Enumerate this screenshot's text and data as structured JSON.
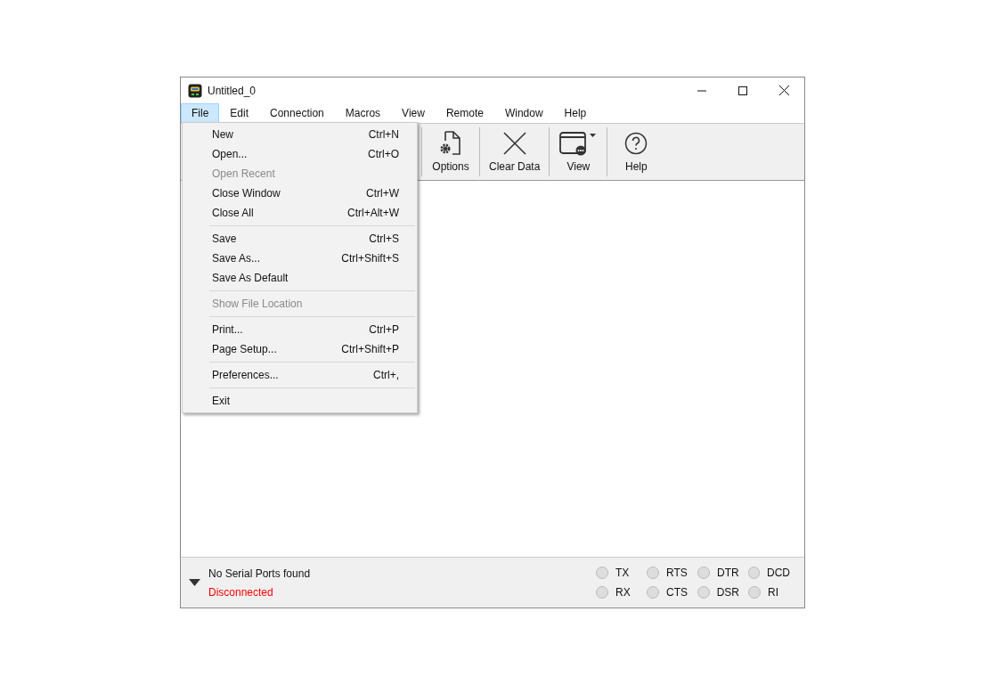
{
  "window": {
    "title": "Untitled_0"
  },
  "menu_bar": [
    {
      "label": "File",
      "selected": true
    },
    {
      "label": "Edit",
      "selected": false
    },
    {
      "label": "Connection",
      "selected": false
    },
    {
      "label": "Macros",
      "selected": false
    },
    {
      "label": "View",
      "selected": false
    },
    {
      "label": "Remote",
      "selected": false
    },
    {
      "label": "Window",
      "selected": false
    },
    {
      "label": "Help",
      "selected": false
    }
  ],
  "toolbar": [
    {
      "kind": "options",
      "label": "Options"
    },
    {
      "kind": "clear",
      "label": "Clear Data"
    },
    {
      "kind": "view",
      "label": "View"
    },
    {
      "kind": "help",
      "label": "Help"
    }
  ],
  "file_menu": [
    {
      "kind": "item",
      "label": "New",
      "shortcut": "Ctrl+N",
      "disabled": false
    },
    {
      "kind": "item",
      "label": "Open...",
      "shortcut": "Ctrl+O",
      "disabled": false
    },
    {
      "kind": "item",
      "label": "Open Recent",
      "disabled": true
    },
    {
      "kind": "item",
      "label": "Close Window",
      "shortcut": "Ctrl+W",
      "disabled": false
    },
    {
      "kind": "item",
      "label": "Close All",
      "shortcut": "Ctrl+Alt+W",
      "disabled": false
    },
    {
      "kind": "separator"
    },
    {
      "kind": "item",
      "label": "Save",
      "shortcut": "Ctrl+S",
      "disabled": false
    },
    {
      "kind": "item",
      "label": "Save As...",
      "shortcut": "Ctrl+Shift+S",
      "disabled": false
    },
    {
      "kind": "item",
      "label": "Save As Default",
      "disabled": false
    },
    {
      "kind": "separator"
    },
    {
      "kind": "item",
      "label": "Show File Location",
      "disabled": true
    },
    {
      "kind": "separator"
    },
    {
      "kind": "item",
      "label": "Print...",
      "shortcut": "Ctrl+P",
      "disabled": false
    },
    {
      "kind": "item",
      "label": "Page Setup...",
      "shortcut": "Ctrl+Shift+P",
      "disabled": false
    },
    {
      "kind": "separator"
    },
    {
      "kind": "item",
      "label": "Preferences...",
      "shortcut": "Ctrl+,",
      "disabled": false
    },
    {
      "kind": "separator"
    },
    {
      "kind": "item",
      "label": "Exit",
      "disabled": false
    }
  ],
  "status_bar": {
    "port": "No Serial Ports found",
    "connection": "Disconnected",
    "signals": [
      {
        "label": "TX",
        "on": false
      },
      {
        "label": "RTS",
        "on": false
      },
      {
        "label": "DTR",
        "on": false
      },
      {
        "label": "DCD",
        "on": false
      },
      {
        "label": "RX",
        "on": false
      },
      {
        "label": "CTS",
        "on": false
      },
      {
        "label": "DSR",
        "on": false
      },
      {
        "label": "RI",
        "on": false
      }
    ]
  }
}
